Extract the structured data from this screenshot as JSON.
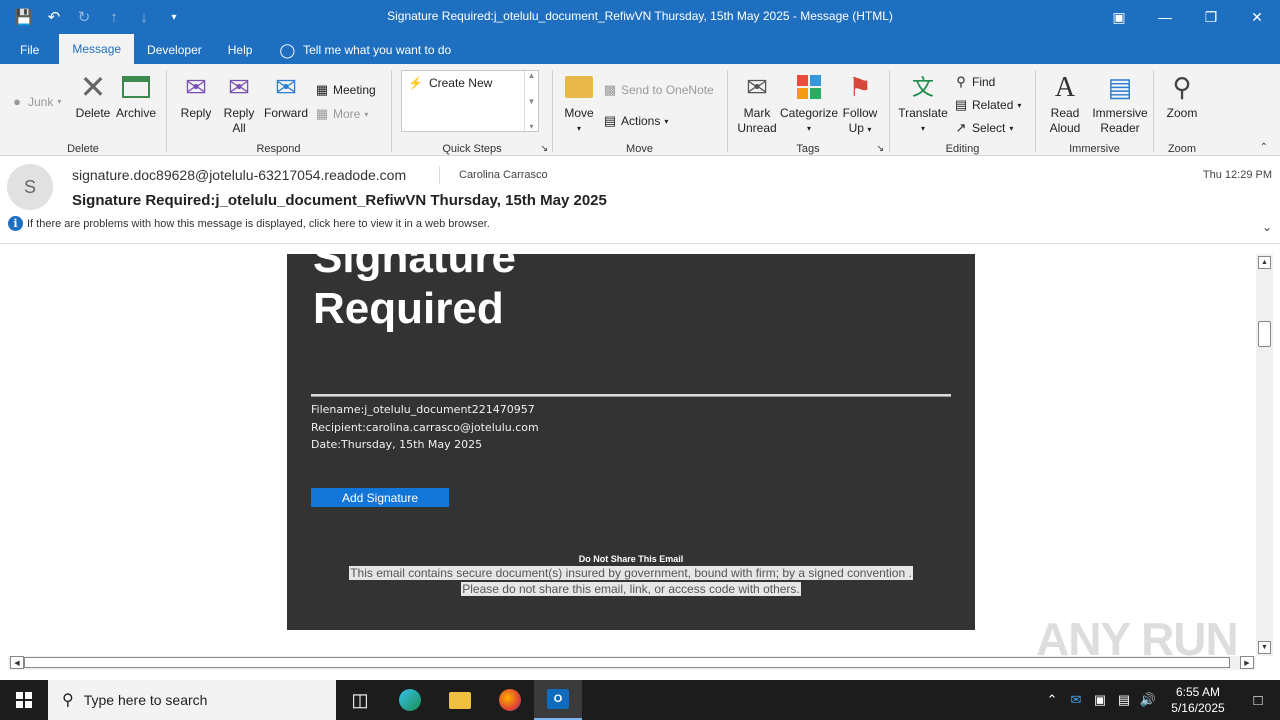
{
  "window": {
    "title": "Signature Required:j_otelulu_document_RefiwVN Thursday, 15th May 2025  -  Message (HTML)"
  },
  "menu": {
    "tabs": [
      "File",
      "Message",
      "Developer",
      "Help"
    ],
    "tell_me": "Tell me what you want to do"
  },
  "ribbon": {
    "junk": "Junk",
    "delete": "Delete",
    "archive": "Archive",
    "group_delete": "Delete",
    "reply": "Reply",
    "reply_all": "Reply All",
    "reply_all_l1": "Reply",
    "reply_all_l2": "All",
    "forward": "Forward",
    "meeting": "Meeting",
    "more": "More",
    "group_respond": "Respond",
    "create_new": "Create New",
    "group_quicksteps": "Quick Steps",
    "move": "Move",
    "send_onenote": "Send to OneNote",
    "actions": "Actions",
    "group_move": "Move",
    "mark_unread_l1": "Mark",
    "mark_unread_l2": "Unread",
    "categorize": "Categorize",
    "follow_up_l1": "Follow",
    "follow_up_l2": "Up",
    "group_tags": "Tags",
    "translate": "Translate",
    "find": "Find",
    "related": "Related",
    "select": "Select",
    "group_editing": "Editing",
    "read_aloud_l1": "Read",
    "read_aloud_l2": "Aloud",
    "immersive_l1": "Immersive",
    "immersive_l2": "Reader",
    "group_immersive": "Immersive",
    "zoom": "Zoom",
    "group_zoom": "Zoom"
  },
  "message": {
    "avatar_initial": "S",
    "from": "signature.doc89628@jotelulu-63217054.readode.com",
    "to": "Carolina Carrasco",
    "time": "Thu 12:29 PM",
    "subject": "Signature Required:j_otelulu_document_RefiwVN Thursday, 15th May 2025",
    "info_bar": "If there are problems with how this message is displayed, click here to view it in a web browser."
  },
  "email_body": {
    "title_line1": "Signature",
    "title_line2": "Required",
    "filename": "Filename:j_otelulu_document221470957",
    "recipient": "Recipient:carolina.carrasco@jotelulu.com",
    "date": "Date:Thursday, 15th May 2025",
    "add_signature": "Add Signature",
    "do_not_share": "Do Not Share This Email",
    "disclaimer_line1": "This email contains secure document(s) insured by government, bound with firm; by a signed convention .",
    "disclaimer_line2": "Please do not share this email, link, or access code with others."
  },
  "watermark": "ANY RUN",
  "taskbar": {
    "search_placeholder": "Type here to search",
    "clock_time": "6:55 AM",
    "clock_date": "5/16/2025"
  }
}
